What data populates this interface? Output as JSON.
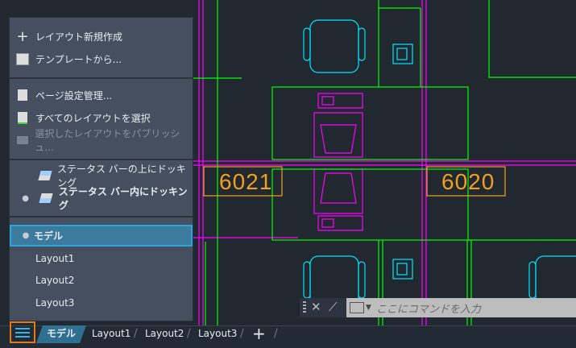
{
  "drawing": {
    "rooms": [
      "6021",
      "6020"
    ]
  },
  "menu": {
    "items": [
      {
        "label": "レイアウト新規作成",
        "icon": "plus-icon"
      },
      {
        "label": "テンプレートから...",
        "icon": "template-icon"
      },
      {
        "label": "ページ設定管理...",
        "icon": "page-setup-icon"
      },
      {
        "label": "すべてのレイアウトを選択",
        "icon": "select-all-layouts-icon"
      },
      {
        "label": "選択したレイアウトをパブリッシュ...",
        "icon": "publish-icon",
        "disabled": true
      },
      {
        "label": "ステータス バーの上にドッキング",
        "icon": "dock-above-icon"
      },
      {
        "label": "ステータス バー内にドッキング",
        "icon": "dock-inside-icon",
        "checked": true
      },
      {
        "label": "モデル",
        "checked": true,
        "selected": true
      },
      {
        "label": "Layout1"
      },
      {
        "label": "Layout2"
      },
      {
        "label": "Layout3"
      }
    ]
  },
  "command": {
    "placeholder": "ここにコマンドを入力"
  },
  "tabs": [
    {
      "label": "モデル",
      "active": true
    },
    {
      "label": "Layout1"
    },
    {
      "label": "Layout2"
    },
    {
      "label": "Layout3"
    },
    {
      "label": "+"
    }
  ],
  "colors": {
    "accent": "#2fa3dc",
    "highlight": "#e07a18",
    "walls": "#00ff00",
    "furniture": "#00e5ff",
    "magenta": "#ff00ff",
    "label": "#f0a020"
  }
}
